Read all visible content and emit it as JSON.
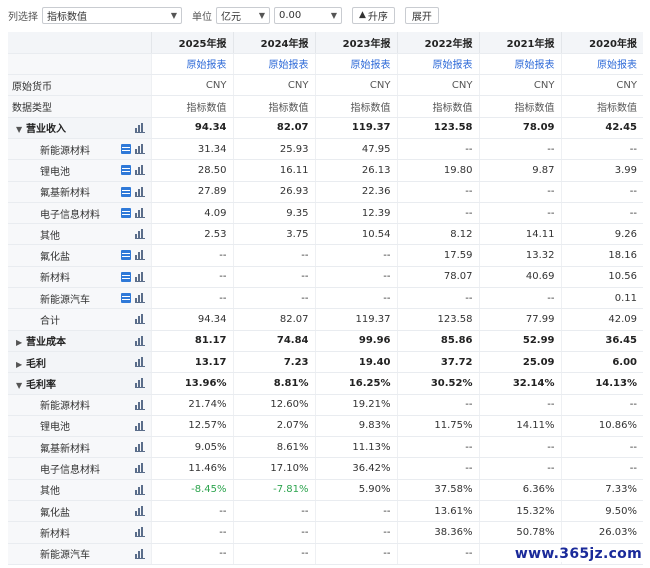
{
  "toolbar": {
    "col_select_label": "列选择",
    "col_select_value": "指标数值",
    "unit_label": "单位",
    "unit_value": "亿元",
    "decimal_value": "0.00",
    "sort_label": "升序",
    "expand_label": "展开"
  },
  "years": [
    "2025年报",
    "2024年报",
    "2023年报",
    "2022年报",
    "2021年报",
    "2020年报"
  ],
  "source_link": "原始报表",
  "rows": [
    {
      "name": "原始货币",
      "type": "meta",
      "values": [
        "CNY",
        "CNY",
        "CNY",
        "CNY",
        "CNY",
        "CNY"
      ]
    },
    {
      "name": "数据类型",
      "type": "meta",
      "values": [
        "指标数值",
        "指标数值",
        "指标数值",
        "指标数值",
        "指标数值",
        "指标数值"
      ]
    },
    {
      "name": "营业收入",
      "type": "group",
      "tri": "▼",
      "values": [
        "94.34",
        "82.07",
        "119.37",
        "123.58",
        "78.09",
        "42.45"
      ]
    },
    {
      "name": "新能源材料",
      "type": "sub",
      "tbl": true,
      "values": [
        "31.34",
        "25.93",
        "47.95",
        "--",
        "--",
        "--"
      ]
    },
    {
      "name": "锂电池",
      "type": "sub",
      "tbl": true,
      "values": [
        "28.50",
        "16.11",
        "26.13",
        "19.80",
        "9.87",
        "3.99"
      ]
    },
    {
      "name": "氟基新材料",
      "type": "sub",
      "tbl": true,
      "values": [
        "27.89",
        "26.93",
        "22.36",
        "--",
        "--",
        "--"
      ]
    },
    {
      "name": "电子信息材料",
      "type": "sub",
      "tbl": true,
      "values": [
        "4.09",
        "9.35",
        "12.39",
        "--",
        "--",
        "--"
      ]
    },
    {
      "name": "其他",
      "type": "sub",
      "values": [
        "2.53",
        "3.75",
        "10.54",
        "8.12",
        "14.11",
        "9.26"
      ]
    },
    {
      "name": "氟化盐",
      "type": "sub",
      "tbl": true,
      "values": [
        "--",
        "--",
        "--",
        "17.59",
        "13.32",
        "18.16"
      ]
    },
    {
      "name": "新材料",
      "type": "sub",
      "tbl": true,
      "values": [
        "--",
        "--",
        "--",
        "78.07",
        "40.69",
        "10.56"
      ]
    },
    {
      "name": "新能源汽车",
      "type": "sub",
      "tbl": true,
      "values": [
        "--",
        "--",
        "--",
        "--",
        "--",
        "0.11"
      ]
    },
    {
      "name": "合计",
      "type": "sub",
      "values": [
        "94.34",
        "82.07",
        "119.37",
        "123.58",
        "77.99",
        "42.09"
      ]
    },
    {
      "name": "营业成本",
      "type": "group",
      "tri": "▶",
      "values": [
        "81.17",
        "74.84",
        "99.96",
        "85.86",
        "52.99",
        "36.45"
      ]
    },
    {
      "name": "毛利",
      "type": "group",
      "tri": "▶",
      "values": [
        "13.17",
        "7.23",
        "19.40",
        "37.72",
        "25.09",
        "6.00"
      ]
    },
    {
      "name": "毛利率",
      "type": "group",
      "tri": "▼",
      "values": [
        "13.96%",
        "8.81%",
        "16.25%",
        "30.52%",
        "32.14%",
        "14.13%"
      ]
    },
    {
      "name": "新能源材料",
      "type": "sub",
      "values": [
        "21.74%",
        "12.60%",
        "19.21%",
        "--",
        "--",
        "--"
      ]
    },
    {
      "name": "锂电池",
      "type": "sub",
      "values": [
        "12.57%",
        "2.07%",
        "9.83%",
        "11.75%",
        "14.11%",
        "10.86%"
      ]
    },
    {
      "name": "氟基新材料",
      "type": "sub",
      "values": [
        "9.05%",
        "8.61%",
        "11.13%",
        "--",
        "--",
        "--"
      ]
    },
    {
      "name": "电子信息材料",
      "type": "sub",
      "values": [
        "11.46%",
        "17.10%",
        "36.42%",
        "--",
        "--",
        "--"
      ]
    },
    {
      "name": "其他",
      "type": "sub",
      "values": [
        "-8.45%",
        "-7.81%",
        "5.90%",
        "37.58%",
        "6.36%",
        "7.33%"
      ]
    },
    {
      "name": "氟化盐",
      "type": "sub",
      "values": [
        "--",
        "--",
        "--",
        "13.61%",
        "15.32%",
        "9.50%"
      ]
    },
    {
      "name": "新材料",
      "type": "sub",
      "values": [
        "--",
        "--",
        "--",
        "38.36%",
        "50.78%",
        "26.03%"
      ]
    },
    {
      "name": "新能源汽车",
      "type": "sub",
      "values": [
        "--",
        "--",
        "--",
        "--",
        "--",
        ""
      ]
    }
  ],
  "colors": {
    "link": "#2f6bd8",
    "negative": "#2da44e",
    "header_bg": "#f3f5f8"
  },
  "watermark": "www.365jz.com"
}
